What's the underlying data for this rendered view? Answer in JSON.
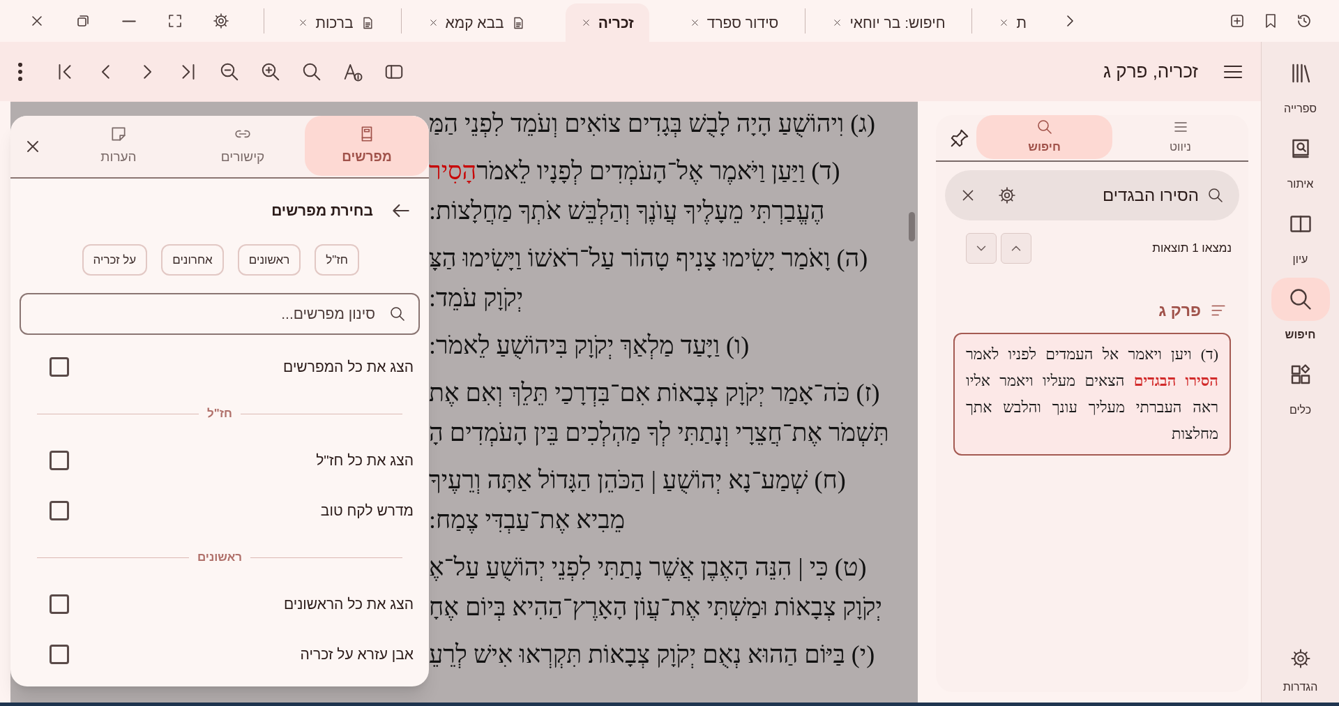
{
  "tabs": [
    {
      "label": "ת",
      "kind": "plain",
      "selected": false
    },
    {
      "label": "חיפוש: בר יוחאי",
      "kind": "plain",
      "selected": false
    },
    {
      "label": "סידור ספרד",
      "kind": "plain",
      "selected": false
    },
    {
      "label": "זכריה",
      "kind": "plain",
      "selected": true
    },
    {
      "label": "בבא קמא",
      "kind": "document",
      "selected": false
    },
    {
      "label": "ברכות",
      "kind": "document",
      "selected": false
    }
  ],
  "toolbar": {
    "title": "זכריה, פרק ג"
  },
  "sidebar": {
    "items": [
      {
        "label": "ספרייה",
        "selected": false
      },
      {
        "label": "איתור",
        "selected": false
      },
      {
        "label": "עיון",
        "selected": false
      },
      {
        "label": "חיפוש",
        "selected": true
      },
      {
        "label": "כלים",
        "selected": false
      }
    ],
    "settings": "הגדרות"
  },
  "search_panel": {
    "tabs": [
      {
        "label": "ניווט",
        "selected": false
      },
      {
        "label": "חיפוש",
        "selected": true
      }
    ],
    "query": "הסירו הבגדים",
    "result_count": "נמצאו 1 תוצאות",
    "group": "פרק ג",
    "results": [
      "(ד) ויען ויאמר אל העמדים לפניו לאמר **הסירו הבגדים** הצאים מעליו ויאמר אליו ראה העברתי מעליך עונך והלבש אתך מחלצות"
    ]
  },
  "reader": {
    "verses": [
      {
        "lines": [
          [
            {
              "text": "(ג) וִיהוֹשֻׁעַ הָיָה לָבֻשׁ בְּגָדִים צוֹאִים וְעֹמֵד לִפְנֵי הַמַּ",
              "highlight": false
            }
          ]
        ]
      },
      {
        "lines": [
          [
            {
              "text": "(ד) וַיַּעַן וַיֹּאמֶר אֶל־הָעֹמְדִים לְפָנָיו לֵאמֹר ",
              "highlight": false
            },
            {
              "text": "הָסִיר",
              "highlight": true
            }
          ],
          [
            {
              "text": "הֶעֱבַרְתִּי מֵעָלֶיךָ עֲוֺנֶךָ וְהַלְבֵּשׁ אֹתְךָ מַחֲלָצוֹת:",
              "highlight": false
            }
          ]
        ]
      },
      {
        "lines": [
          [
            {
              "text": "(ה) וָאֹמַר יָשִׂימוּ צָנִיף טָהוֹר עַל־רֹאשׁוֹ וַיָּשִׂימוּ הַצָּ",
              "highlight": false
            }
          ],
          [
            {
              "text": "יְקֹוָק עֹמֵד:",
              "highlight": false
            }
          ]
        ]
      },
      {
        "lines": [
          [
            {
              "text": "(ו) וַיָּעַד מַלְאַךְ יְקֹוָק בִּיהוֹשֻׁעַ לֵאמֹר:",
              "highlight": false
            }
          ]
        ]
      },
      {
        "lines": [
          [
            {
              "text": "(ז) כֹּה־אָמַר יְקֹוָק צְבָאוֹת אִם־בִּדְרָכַי תֵּלֵךְ וְאִם אֶת",
              "highlight": false
            }
          ],
          [
            {
              "text": "תִּשְׁמֹר אֶת־חֲצֵרָי וְנָתַתִּי לְךָ מַהְלְכִים בֵּין הָעֹמְדִים הָ",
              "highlight": false
            }
          ]
        ]
      },
      {
        "lines": [
          [
            {
              "text": "(ח) שְׁמַע־נָא יְהוֹשֻׁעַ | הַכֹּהֵן הַגָּדוֹל אַתָּה וְרֵעֶיךָ",
              "highlight": false
            }
          ],
          [
            {
              "text": "מֵבִיא אֶת־עַבְדִּי צֶמַח:",
              "highlight": false
            }
          ]
        ]
      },
      {
        "lines": [
          [
            {
              "text": "(ט) כִּי | הִנֵּה הָאֶבֶן אֲשֶׁר נָתַתִּי לִפְנֵי יְהוֹשֻׁעַ עַל־אֶ",
              "highlight": false
            }
          ],
          [
            {
              "text": "יְקֹוָק צְבָאוֹת וּמַשְׁתִּי אֶת־עֲוֹן הָאָרֶץ־הַהִיא בְּיוֹם אֶחָ",
              "highlight": false
            }
          ]
        ]
      },
      {
        "lines": [
          [
            {
              "text": "(י) בַּיּוֹם הַהוּא נְאֻם יְקֹוָק צְבָאוֹת תִּקְרְאוּ אִישׁ לְרֵעֵ",
              "highlight": false
            }
          ]
        ]
      }
    ]
  },
  "commentary_panel": {
    "tabs": [
      {
        "label": "מפרשים",
        "selected": true
      },
      {
        "label": "קישורים",
        "selected": false
      },
      {
        "label": "הערות",
        "selected": false
      }
    ],
    "heading": "בחירת מפרשים",
    "filter_chips": [
      "חז\"ל",
      "ראשונים",
      "אחרונים",
      "על זכריה"
    ],
    "filter": {
      "placeholder": "סינון מפרשים..."
    },
    "items": [
      {
        "kind": "checkbox",
        "label": "הצג את כל המפרשים",
        "checked": false
      },
      {
        "kind": "section",
        "label": "חז\"ל"
      },
      {
        "kind": "checkbox",
        "label": "הצג את כל חז\"ל",
        "checked": false
      },
      {
        "kind": "checkbox",
        "label": "מדרש לקח טוב",
        "checked": false
      },
      {
        "kind": "section",
        "label": "ראשונים"
      },
      {
        "kind": "checkbox",
        "label": "הצג את כל הראשונים",
        "checked": false
      },
      {
        "kind": "checkbox",
        "label": "אבן עזרא על זכריה",
        "checked": false
      }
    ]
  }
}
